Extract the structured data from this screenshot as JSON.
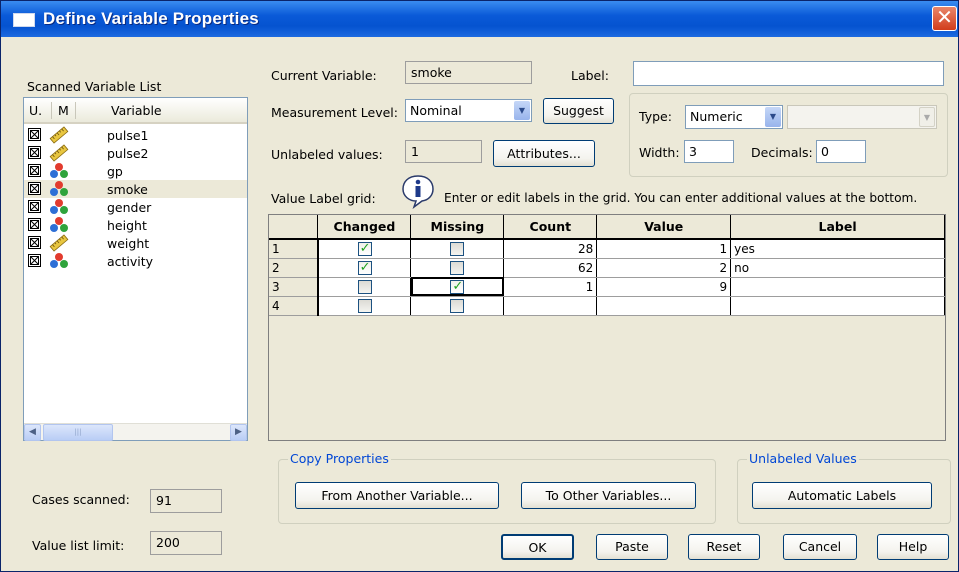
{
  "window": {
    "title": "Define Variable Properties",
    "close_glyph": "✕"
  },
  "scanned_list": {
    "title": "Scanned Variable List",
    "col_u": "U.",
    "col_m": "M",
    "col_variable": "Variable",
    "rows": [
      {
        "name": "pulse1",
        "checked": true,
        "measure_icon": "scale-ruler-icon"
      },
      {
        "name": "pulse2",
        "checked": true,
        "measure_icon": "scale-ruler-icon"
      },
      {
        "name": "gp",
        "checked": true,
        "measure_icon": "nominal-balls-icon"
      },
      {
        "name": "smoke",
        "checked": true,
        "measure_icon": "nominal-balls-icon",
        "selected": true
      },
      {
        "name": "gender",
        "checked": true,
        "measure_icon": "nominal-balls-icon"
      },
      {
        "name": "height",
        "checked": true,
        "measure_icon": "nominal-balls-icon"
      },
      {
        "name": "weight",
        "checked": true,
        "measure_icon": "scale-ruler-icon"
      },
      {
        "name": "activity",
        "checked": true,
        "measure_icon": "nominal-balls-icon"
      }
    ],
    "cases_scanned_label": "Cases scanned:",
    "cases_scanned": "91",
    "value_list_limit_label": "Value list limit:",
    "value_list_limit": "200"
  },
  "current": {
    "label": "Current Variable:",
    "value": "smoke",
    "label_label": "Label:",
    "label_value": "",
    "measurement_label": "Measurement Level:",
    "measurement_value": "Nominal",
    "suggest": "Suggest",
    "unlabeled_label": "Unlabeled values:",
    "unlabeled_value": "1",
    "attributes": "Attributes...",
    "type_label": "Type:",
    "type_value": "Numeric",
    "type_extra": "",
    "width_label": "Width:",
    "width_value": "3",
    "decimals_label": "Decimals:",
    "decimals_value": "0"
  },
  "grid": {
    "caption": "Value Label grid:",
    "info": "Enter or edit labels in the grid.  You can enter additional values at the bottom.",
    "headers": [
      "",
      "Changed",
      "Missing",
      "Count",
      "Value",
      "Label"
    ],
    "rows": [
      {
        "n": "1",
        "changed": true,
        "missing": false,
        "count": "28",
        "value": "1",
        "label": "yes"
      },
      {
        "n": "2",
        "changed": true,
        "missing": false,
        "count": "62",
        "value": "2",
        "label": "no"
      },
      {
        "n": "3",
        "changed": false,
        "missing": true,
        "count": "1",
        "value": "9",
        "label": ""
      },
      {
        "n": "4",
        "changed": false,
        "missing": false,
        "count": "",
        "value": "",
        "label": ""
      }
    ]
  },
  "copy_properties": {
    "title": "Copy Properties",
    "from": "From Another Variable...",
    "to": "To Other Variables..."
  },
  "unlabeled_values": {
    "title": "Unlabeled Values",
    "auto": "Automatic Labels"
  },
  "footer": {
    "ok": "OK",
    "paste": "Paste",
    "reset": "Reset",
    "cancel": "Cancel",
    "help": "Help"
  }
}
